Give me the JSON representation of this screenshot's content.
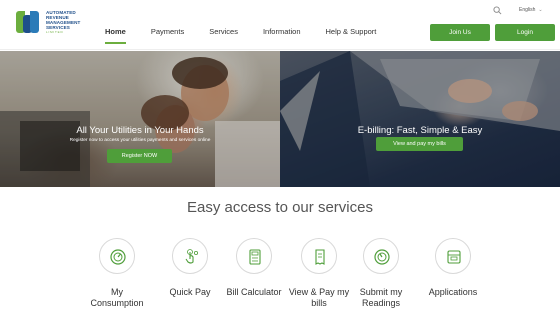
{
  "header": {
    "logo_text": [
      "AUTOMATED",
      "REVENUE",
      "MANAGEMENT",
      "SERVICES"
    ],
    "logo_small": "LIMITED",
    "nav": [
      "Home",
      "Payments",
      "Services",
      "Information",
      "Help & Support"
    ],
    "active_nav": "Home",
    "language": "English",
    "join_label": "Join Us",
    "login_label": "Login"
  },
  "hero": {
    "left": {
      "title": "All Your Utilities in Your Hands",
      "subtitle": "Register now to access your utilities payments and services online",
      "button": "Register NOW"
    },
    "right": {
      "title": "E-billing: Fast, Simple & Easy",
      "button": "View and pay my bills"
    }
  },
  "services": {
    "title": "Easy access to our services",
    "items": [
      {
        "label": "My Consumption",
        "icon": "gauge-icon"
      },
      {
        "label": "Quick Pay",
        "icon": "touch-pay-icon"
      },
      {
        "label": "Bill Calculator",
        "icon": "calculator-icon"
      },
      {
        "label": "View & Pay my bills",
        "icon": "bill-icon"
      },
      {
        "label": "Submit my Readings",
        "icon": "meter-icon"
      },
      {
        "label": "Applications",
        "icon": "application-icon"
      }
    ]
  },
  "colors": {
    "accent": "#4f9e3a",
    "brand_blue": "#1f4f8a",
    "brand_green": "#6cae3e"
  }
}
